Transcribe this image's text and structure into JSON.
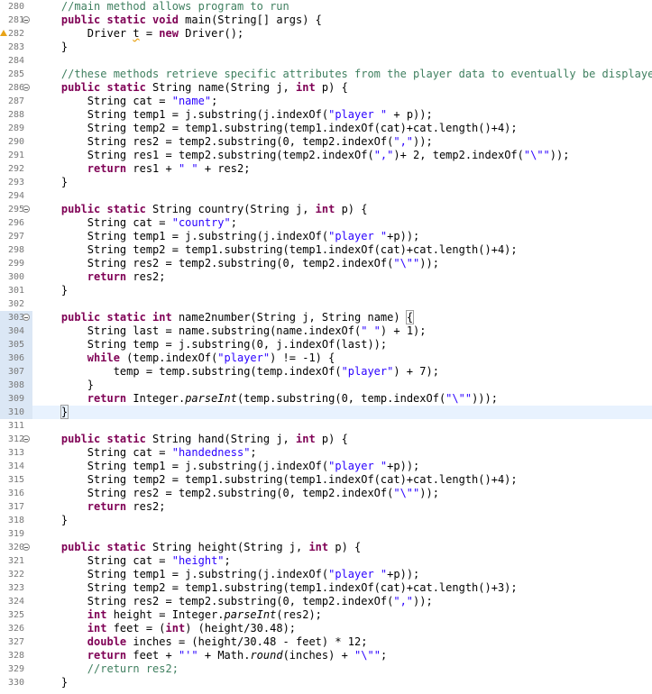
{
  "editor": {
    "current_line": 310,
    "lines": [
      {
        "n": "280",
        "fold": false,
        "code": [
          [
            "cm",
            "    //main method allows program to run"
          ]
        ]
      },
      {
        "n": "281",
        "fold": true,
        "code": [
          [
            "t",
            "    "
          ],
          [
            "kw",
            "public static void"
          ],
          [
            "t",
            " main(String[] args) {"
          ]
        ]
      },
      {
        "n": "282",
        "fold": false,
        "warn": true,
        "code": [
          [
            "t",
            "        Driver "
          ],
          [
            "wv",
            "t"
          ],
          [
            "t",
            " = "
          ],
          [
            "kw",
            "new"
          ],
          [
            "t",
            " Driver();"
          ]
        ]
      },
      {
        "n": "283",
        "fold": false,
        "code": [
          [
            "t",
            "    }"
          ]
        ]
      },
      {
        "n": "284",
        "fold": false,
        "code": []
      },
      {
        "n": "285",
        "fold": false,
        "code": [
          [
            "cm",
            "    //these methods retrieve specific attributes from the player data to eventually be displayed"
          ]
        ]
      },
      {
        "n": "286",
        "fold": true,
        "code": [
          [
            "t",
            "    "
          ],
          [
            "kw",
            "public static"
          ],
          [
            "t",
            " String name(String j, "
          ],
          [
            "kw",
            "int"
          ],
          [
            "t",
            " p) {"
          ]
        ]
      },
      {
        "n": "287",
        "fold": false,
        "code": [
          [
            "t",
            "        String cat = "
          ],
          [
            "str",
            "\"name\""
          ],
          [
            "t",
            ";"
          ]
        ]
      },
      {
        "n": "288",
        "fold": false,
        "code": [
          [
            "t",
            "        String temp1 = j.substring(j.indexOf("
          ],
          [
            "str",
            "\"player \""
          ],
          [
            "t",
            " + p));"
          ]
        ]
      },
      {
        "n": "289",
        "fold": false,
        "code": [
          [
            "t",
            "        String temp2 = temp1.substring(temp1.indexOf(cat)+cat.length()+4);"
          ]
        ]
      },
      {
        "n": "290",
        "fold": false,
        "code": [
          [
            "t",
            "        String res2 = temp2.substring(0, temp2.indexOf("
          ],
          [
            "str",
            "\",\""
          ],
          [
            "t",
            "));"
          ]
        ]
      },
      {
        "n": "291",
        "fold": false,
        "code": [
          [
            "t",
            "        String res1 = temp2.substring(temp2.indexOf("
          ],
          [
            "str",
            "\",\""
          ],
          [
            "t",
            ")+ 2, temp2.indexOf("
          ],
          [
            "str",
            "\"\\\"\""
          ],
          [
            "t",
            "));"
          ]
        ]
      },
      {
        "n": "292",
        "fold": false,
        "code": [
          [
            "t",
            "        "
          ],
          [
            "kw",
            "return"
          ],
          [
            "t",
            " res1 + "
          ],
          [
            "str",
            "\" \""
          ],
          [
            "t",
            " + res2;"
          ]
        ]
      },
      {
        "n": "293",
        "fold": false,
        "code": [
          [
            "t",
            "    }"
          ]
        ]
      },
      {
        "n": "294",
        "fold": false,
        "code": []
      },
      {
        "n": "295",
        "fold": true,
        "code": [
          [
            "t",
            "    "
          ],
          [
            "kw",
            "public static"
          ],
          [
            "t",
            " String country(String j, "
          ],
          [
            "kw",
            "int"
          ],
          [
            "t",
            " p) {"
          ]
        ]
      },
      {
        "n": "296",
        "fold": false,
        "code": [
          [
            "t",
            "        String cat = "
          ],
          [
            "str",
            "\"country\""
          ],
          [
            "t",
            ";"
          ]
        ]
      },
      {
        "n": "297",
        "fold": false,
        "code": [
          [
            "t",
            "        String temp1 = j.substring(j.indexOf("
          ],
          [
            "str",
            "\"player \""
          ],
          [
            "t",
            "+p));"
          ]
        ]
      },
      {
        "n": "298",
        "fold": false,
        "code": [
          [
            "t",
            "        String temp2 = temp1.substring(temp1.indexOf(cat)+cat.length()+4);"
          ]
        ]
      },
      {
        "n": "299",
        "fold": false,
        "code": [
          [
            "t",
            "        String res2 = temp2.substring(0, temp2.indexOf("
          ],
          [
            "str",
            "\"\\\"\""
          ],
          [
            "t",
            "));"
          ]
        ]
      },
      {
        "n": "300",
        "fold": false,
        "code": [
          [
            "t",
            "        "
          ],
          [
            "kw",
            "return"
          ],
          [
            "t",
            " res2;"
          ]
        ]
      },
      {
        "n": "301",
        "fold": false,
        "code": [
          [
            "t",
            "    }"
          ]
        ]
      },
      {
        "n": "302",
        "fold": false,
        "code": []
      },
      {
        "n": "303",
        "fold": true,
        "changed": true,
        "code": [
          [
            "t",
            "    "
          ],
          [
            "kw",
            "public static int"
          ],
          [
            "t",
            " name2number(String j, String name) "
          ],
          [
            "bx",
            "{"
          ]
        ]
      },
      {
        "n": "304",
        "fold": false,
        "changed": true,
        "code": [
          [
            "t",
            "        String last = name.substring(name.indexOf("
          ],
          [
            "str",
            "\" \""
          ],
          [
            "t",
            ") + 1);"
          ]
        ]
      },
      {
        "n": "305",
        "fold": false,
        "changed": true,
        "code": [
          [
            "t",
            "        String temp = j.substring(0, j.indexOf(last));"
          ]
        ]
      },
      {
        "n": "306",
        "fold": false,
        "changed": true,
        "code": [
          [
            "t",
            "        "
          ],
          [
            "kw",
            "while"
          ],
          [
            "t",
            " (temp.indexOf("
          ],
          [
            "str",
            "\"player\""
          ],
          [
            "t",
            ") != -1) {"
          ]
        ]
      },
      {
        "n": "307",
        "fold": false,
        "changed": true,
        "code": [
          [
            "t",
            "            temp = temp.substring(temp.indexOf("
          ],
          [
            "str",
            "\"player\""
          ],
          [
            "t",
            ") + 7);"
          ]
        ]
      },
      {
        "n": "308",
        "fold": false,
        "changed": true,
        "code": [
          [
            "t",
            "        }"
          ]
        ]
      },
      {
        "n": "309",
        "fold": false,
        "changed": true,
        "code": [
          [
            "t",
            "        "
          ],
          [
            "kw",
            "return"
          ],
          [
            "t",
            " Integer."
          ],
          [
            "it",
            "parseInt"
          ],
          [
            "t",
            "(temp.substring(0, temp.indexOf("
          ],
          [
            "str",
            "\"\\\"\""
          ],
          [
            "t",
            ")));"
          ]
        ]
      },
      {
        "n": "310",
        "fold": false,
        "changed": true,
        "code": [
          [
            "t",
            "    "
          ],
          [
            "bx",
            "}"
          ]
        ]
      },
      {
        "n": "311",
        "fold": false,
        "code": []
      },
      {
        "n": "312",
        "fold": true,
        "code": [
          [
            "t",
            "    "
          ],
          [
            "kw",
            "public static"
          ],
          [
            "t",
            " String hand(String j, "
          ],
          [
            "kw",
            "int"
          ],
          [
            "t",
            " p) {"
          ]
        ]
      },
      {
        "n": "313",
        "fold": false,
        "code": [
          [
            "t",
            "        String cat = "
          ],
          [
            "str",
            "\"handedness\""
          ],
          [
            "t",
            ";"
          ]
        ]
      },
      {
        "n": "314",
        "fold": false,
        "code": [
          [
            "t",
            "        String temp1 = j.substring(j.indexOf("
          ],
          [
            "str",
            "\"player \""
          ],
          [
            "t",
            "+p));"
          ]
        ]
      },
      {
        "n": "315",
        "fold": false,
        "code": [
          [
            "t",
            "        String temp2 = temp1.substring(temp1.indexOf(cat)+cat.length()+4);"
          ]
        ]
      },
      {
        "n": "316",
        "fold": false,
        "code": [
          [
            "t",
            "        String res2 = temp2.substring(0, temp2.indexOf("
          ],
          [
            "str",
            "\"\\\"\""
          ],
          [
            "t",
            "));"
          ]
        ]
      },
      {
        "n": "317",
        "fold": false,
        "code": [
          [
            "t",
            "        "
          ],
          [
            "kw",
            "return"
          ],
          [
            "t",
            " res2;"
          ]
        ]
      },
      {
        "n": "318",
        "fold": false,
        "code": [
          [
            "t",
            "    }"
          ]
        ]
      },
      {
        "n": "319",
        "fold": false,
        "code": []
      },
      {
        "n": "320",
        "fold": true,
        "code": [
          [
            "t",
            "    "
          ],
          [
            "kw",
            "public static"
          ],
          [
            "t",
            " String height(String j, "
          ],
          [
            "kw",
            "int"
          ],
          [
            "t",
            " p) {"
          ]
        ]
      },
      {
        "n": "321",
        "fold": false,
        "code": [
          [
            "t",
            "        String cat = "
          ],
          [
            "str",
            "\"height\""
          ],
          [
            "t",
            ";"
          ]
        ]
      },
      {
        "n": "322",
        "fold": false,
        "code": [
          [
            "t",
            "        String temp1 = j.substring(j.indexOf("
          ],
          [
            "str",
            "\"player \""
          ],
          [
            "t",
            "+p));"
          ]
        ]
      },
      {
        "n": "323",
        "fold": false,
        "code": [
          [
            "t",
            "        String temp2 = temp1.substring(temp1.indexOf(cat)+cat.length()+3);"
          ]
        ]
      },
      {
        "n": "324",
        "fold": false,
        "code": [
          [
            "t",
            "        String res2 = temp2.substring(0, temp2.indexOf("
          ],
          [
            "str",
            "\",\""
          ],
          [
            "t",
            "));"
          ]
        ]
      },
      {
        "n": "325",
        "fold": false,
        "code": [
          [
            "t",
            "        "
          ],
          [
            "kw",
            "int"
          ],
          [
            "t",
            " height = Integer."
          ],
          [
            "it",
            "parseInt"
          ],
          [
            "t",
            "(res2);"
          ]
        ]
      },
      {
        "n": "326",
        "fold": false,
        "code": [
          [
            "t",
            "        "
          ],
          [
            "kw",
            "int"
          ],
          [
            "t",
            " feet = ("
          ],
          [
            "kw",
            "int"
          ],
          [
            "t",
            ") (height/30.48);"
          ]
        ]
      },
      {
        "n": "327",
        "fold": false,
        "code": [
          [
            "t",
            "        "
          ],
          [
            "kw",
            "double"
          ],
          [
            "t",
            " inches = (height/30.48 - feet) * 12;"
          ]
        ]
      },
      {
        "n": "328",
        "fold": false,
        "code": [
          [
            "t",
            "        "
          ],
          [
            "kw",
            "return"
          ],
          [
            "t",
            " feet + "
          ],
          [
            "str",
            "\"'\""
          ],
          [
            "t",
            " + Math."
          ],
          [
            "it",
            "round"
          ],
          [
            "t",
            "(inches) + "
          ],
          [
            "str",
            "\"\\\"\""
          ],
          [
            "t",
            ";"
          ]
        ]
      },
      {
        "n": "329",
        "fold": false,
        "code": [
          [
            "cm",
            "        //return res2;"
          ]
        ]
      },
      {
        "n": "330",
        "fold": false,
        "code": [
          [
            "t",
            "    }"
          ]
        ]
      }
    ]
  }
}
